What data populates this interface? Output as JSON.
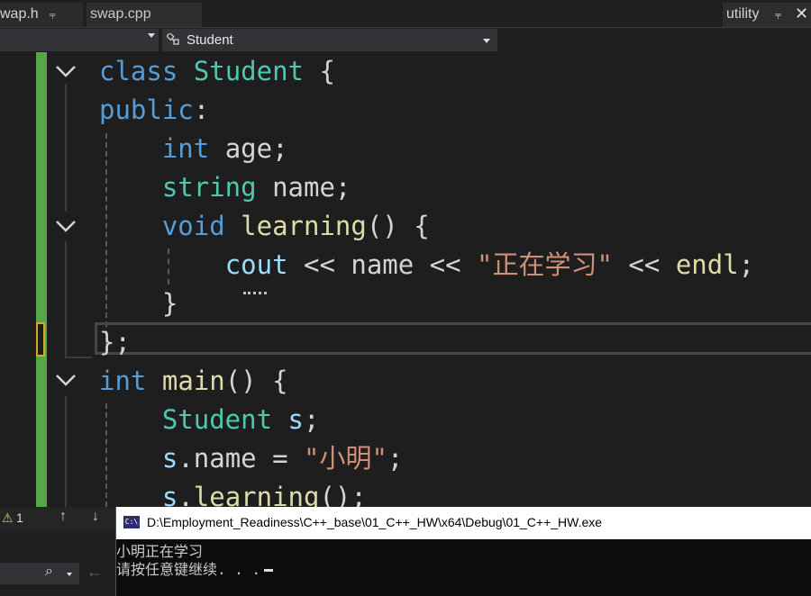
{
  "tabs": [
    {
      "label": "wap.h",
      "pinned": true
    },
    {
      "label": "swap.cpp"
    },
    {
      "label": "utility",
      "pinned": true
    }
  ],
  "navbar": {
    "scope": "",
    "member": "Student"
  },
  "code_lines": [
    [
      [
        "kw",
        "class"
      ],
      [
        "tx",
        " "
      ],
      [
        "ty",
        "Student"
      ],
      [
        "tx",
        " {"
      ]
    ],
    [
      [
        "kw",
        "public"
      ],
      [
        "tx",
        ":"
      ]
    ],
    [
      [
        "tx",
        "    "
      ],
      [
        "kw",
        "int"
      ],
      [
        "tx",
        " age;"
      ]
    ],
    [
      [
        "tx",
        "    "
      ],
      [
        "ty",
        "string"
      ],
      [
        "tx",
        " name;"
      ]
    ],
    [
      [
        "tx",
        "    "
      ],
      [
        "kw",
        "void"
      ],
      [
        "tx",
        " "
      ],
      [
        "fn",
        "learning"
      ],
      [
        "tx",
        "() {"
      ]
    ],
    [
      [
        "tx",
        "        "
      ],
      [
        "va",
        "cout"
      ],
      [
        "tx",
        " << name << "
      ],
      [
        "st",
        "\"正在学习\""
      ],
      [
        "tx",
        " << "
      ],
      [
        "fn",
        "endl"
      ],
      [
        "tx",
        ";"
      ]
    ],
    [
      [
        "tx",
        "    }"
      ]
    ],
    [
      [
        "tx",
        "};"
      ]
    ],
    [
      [
        "kw",
        "int"
      ],
      [
        "tx",
        " "
      ],
      [
        "fn",
        "main"
      ],
      [
        "tx",
        "() {"
      ]
    ],
    [
      [
        "tx",
        "    "
      ],
      [
        "ty",
        "Student"
      ],
      [
        "tx",
        " "
      ],
      [
        "va",
        "s"
      ],
      [
        "tx",
        ";"
      ]
    ],
    [
      [
        "tx",
        "    "
      ],
      [
        "va",
        "s"
      ],
      [
        "tx",
        ".name = "
      ],
      [
        "st",
        "\"小明\""
      ],
      [
        "tx",
        ";"
      ]
    ],
    [
      [
        "tx",
        "    "
      ],
      [
        "va",
        "s"
      ],
      [
        "tx",
        "."
      ],
      [
        "fn",
        "learning"
      ],
      [
        "tx",
        "();"
      ]
    ]
  ],
  "error_list": {
    "warning_count": "1"
  },
  "console": {
    "title": "D:\\Employment_Readiness\\C++_base\\01_C++_HW\\x64\\Debug\\01_C++_HW.exe",
    "icon_label": "C:\\",
    "output": [
      "小明正在学习",
      "请按任意键继续. . ."
    ]
  }
}
